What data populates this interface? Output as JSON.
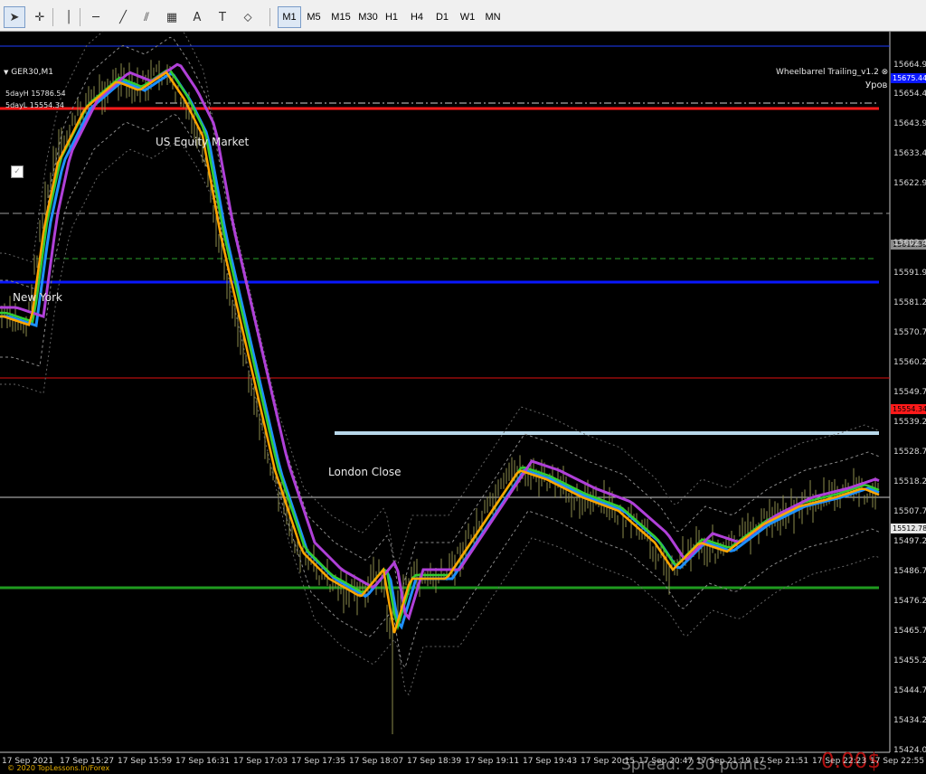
{
  "toolbar": {
    "tools": [
      {
        "icon": "cursor-icon",
        "glyph": "➤"
      },
      {
        "icon": "crosshair-icon",
        "glyph": "✛"
      },
      {
        "icon": "vertical-line-icon",
        "glyph": "│"
      },
      {
        "icon": "horizontal-line-icon",
        "glyph": "─"
      },
      {
        "icon": "trendline-icon",
        "glyph": "╱"
      },
      {
        "icon": "channel-icon",
        "glyph": "⫽"
      },
      {
        "icon": "fibonacci-icon",
        "glyph": "▦"
      },
      {
        "icon": "text-icon",
        "glyph": "A"
      },
      {
        "icon": "text-label-icon",
        "glyph": "T"
      },
      {
        "icon": "shapes-icon",
        "glyph": "⬦"
      }
    ],
    "timeframes": [
      "M1",
      "M5",
      "M15",
      "M30",
      "H1",
      "H4",
      "D1",
      "W1",
      "MN"
    ],
    "active_timeframe": "M1"
  },
  "chart": {
    "symbol": "GER30,M1",
    "indicator_name": "Wheelbarrel Trailing_v1.2",
    "level_label": "Уров",
    "day_high": "5dayH 15786.54",
    "day_low": "5dayL 15554.34",
    "copyright": "© 2020 TopLessons.In/Forex",
    "spread": "Spread: 230 points.",
    "profit": "0.00$",
    "annotations": {
      "us_equity": "US Equity Market",
      "new_york": "New York",
      "london_close": "London Close"
    },
    "price_labels": [
      "15664.90",
      "15654.40",
      "15643.90",
      "15633.40",
      "15622.90",
      "15602.40",
      "15591.90",
      "15581.20",
      "15570.70",
      "15560.20",
      "15549.70",
      "15539.20",
      "15528.70",
      "15518.20",
      "15507.70",
      "15497.20",
      "15486.70",
      "15476.20",
      "15465.70",
      "15455.20",
      "15444.70",
      "15434.20",
      "15424.00"
    ],
    "price_tags": {
      "top_blue": "15675.44",
      "grey": "15612.39",
      "red": "15554.34",
      "current": "15512.78"
    },
    "time_labels": [
      "17 Sep 2021",
      "17 Sep 15:27",
      "17 Sep 15:59",
      "17 Sep 16:31",
      "17 Sep 17:03",
      "17 Sep 17:35",
      "17 Sep 18:07",
      "17 Sep 18:39",
      "17 Sep 19:11",
      "17 Sep 19:43",
      "17 Sep 20:15",
      "17 Sep 20:47",
      "17 Sep 21:19",
      "17 Sep 21:51",
      "17 Sep 22:23",
      "17 Sep 22:55"
    ],
    "colors": {
      "red_level": "#ff1a1a",
      "blue_level": "#0a18ff",
      "green_level": "#1f9a1f",
      "london": "#b8d8ea",
      "candles": "#8c8c4c",
      "ma_fast": "#ffa500",
      "ma_green": "#32cd32",
      "ma_blue": "#1e90ff",
      "ma_purple": "#b040d8",
      "spread_text": "#7a7a7a",
      "profit_text": "#b01010"
    }
  }
}
